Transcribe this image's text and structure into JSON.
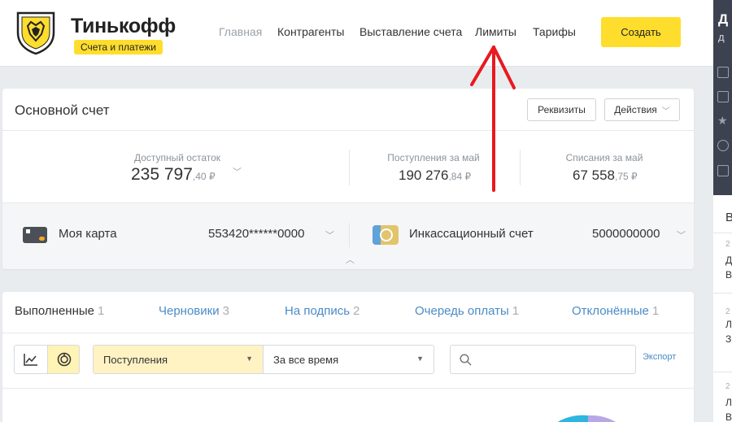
{
  "header": {
    "brand": "Тинькофф",
    "badge": "Счета и платежи",
    "nav": [
      "Главная",
      "Контрагенты",
      "Выставление счета",
      "Лимиты",
      "Тарифы"
    ],
    "create_label": "Создать"
  },
  "account": {
    "title": "Основной счет",
    "details_label": "Реквизиты",
    "actions_label": "Действия",
    "balance": {
      "label": "Доступный остаток",
      "value": "235 797",
      "cents": ",40 ₽"
    },
    "income": {
      "label": "Поступления за май",
      "value": "190 276",
      "cents": ",84 ₽"
    },
    "expense": {
      "label": "Списания за май",
      "value": "67 558",
      "cents": ",75 ₽"
    },
    "card": {
      "name": "Моя карта",
      "number": "553420******0000"
    },
    "collection": {
      "name": "Инкассационный счет",
      "number": "5000000000"
    }
  },
  "tabs": [
    {
      "label": "Выполненные",
      "count": "1"
    },
    {
      "label": "Черновики",
      "count": "3"
    },
    {
      "label": "На подпись",
      "count": "2"
    },
    {
      "label": "Очередь оплаты",
      "count": "1"
    },
    {
      "label": "Отклонённые",
      "count": "1"
    }
  ],
  "filters": {
    "type": "Поступления",
    "period": "За все время",
    "search_placeholder": "",
    "export_label": "Экспорт"
  },
  "sidebar": {
    "title": "Д",
    "subtitle": "д",
    "list_header": "В",
    "items": [
      {
        "date": "2",
        "line1": "Д",
        "line2": "В"
      },
      {
        "date": "2",
        "line1": "Л",
        "line2": "З"
      },
      {
        "date": "2",
        "line1": "Л",
        "line2": "В"
      }
    ]
  },
  "colors": {
    "accent": "#ffdd2d",
    "link": "#4a8bc7",
    "sidebar": "#3d4250",
    "annotation": "#e8191f"
  }
}
